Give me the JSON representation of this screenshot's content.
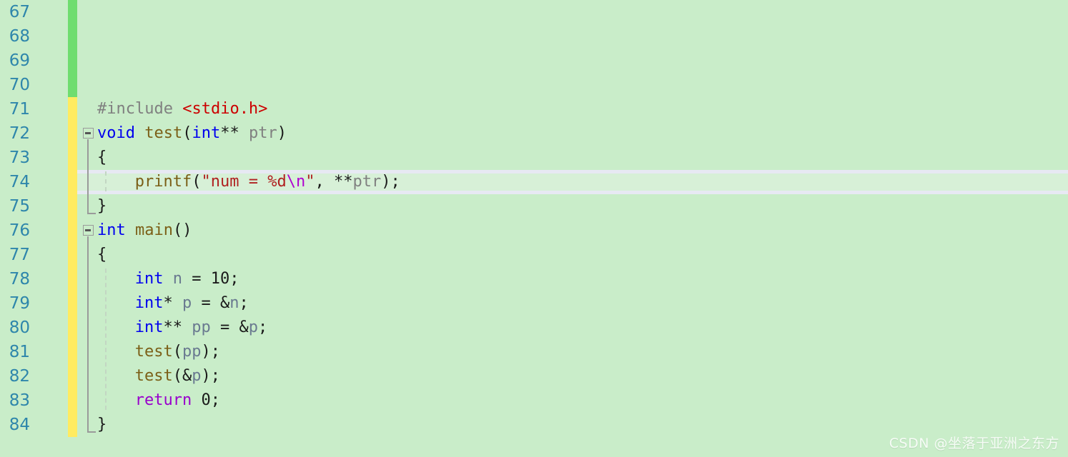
{
  "editor": {
    "background_color": "#c9edc9",
    "line_number_color": "#2e86ab",
    "highlighted_line_number": 74,
    "first_visible_line": 67,
    "last_visible_line": 84
  },
  "gutter": {
    "line_numbers": [
      "67",
      "68",
      "69",
      "70",
      "71",
      "72",
      "73",
      "74",
      "75",
      "76",
      "77",
      "78",
      "79",
      "80",
      "81",
      "82",
      "83",
      "84"
    ],
    "change_bars": [
      {
        "name": "saved-changes-bar",
        "color": "#6fdd6f",
        "from_line": 67,
        "to_line": 70
      },
      {
        "name": "unsaved-changes-bar",
        "color": "#ffeb60",
        "from_line": 71,
        "to_line": 84
      }
    ]
  },
  "fold_markers": [
    {
      "line": 72,
      "state": "expanded",
      "glyph": "minus"
    },
    {
      "line": 76,
      "state": "expanded",
      "glyph": "minus"
    }
  ],
  "code": {
    "language": "c",
    "lines": [
      {
        "number": "67",
        "text": ""
      },
      {
        "number": "68",
        "text": ""
      },
      {
        "number": "69",
        "text": ""
      },
      {
        "number": "70",
        "text": ""
      },
      {
        "number": "71",
        "text": "#include <stdio.h>"
      },
      {
        "number": "72",
        "text": "void test(int** ptr)"
      },
      {
        "number": "73",
        "text": "{"
      },
      {
        "number": "74",
        "text": "    printf(\"num = %d\\n\", **ptr);",
        "highlighted": true
      },
      {
        "number": "75",
        "text": "}"
      },
      {
        "number": "76",
        "text": "int main()"
      },
      {
        "number": "77",
        "text": "{"
      },
      {
        "number": "78",
        "text": "    int n = 10;"
      },
      {
        "number": "79",
        "text": "    int* p = &n;"
      },
      {
        "number": "80",
        "text": "    int** pp = &p;"
      },
      {
        "number": "81",
        "text": "    test(pp);"
      },
      {
        "number": "82",
        "text": "    test(&p);"
      },
      {
        "number": "83",
        "text": "    return 0;"
      },
      {
        "number": "84",
        "text": "}"
      }
    ],
    "tokens": {
      "l71": [
        {
          "t": "#include ",
          "c": "pp"
        },
        {
          "t": "<stdio.h>",
          "c": "inc"
        }
      ],
      "l72": [
        {
          "t": "void",
          "c": "k"
        },
        {
          "t": " ",
          "c": "op"
        },
        {
          "t": "test",
          "c": "fn"
        },
        {
          "t": "(",
          "c": "op"
        },
        {
          "t": "int",
          "c": "k"
        },
        {
          "t": "**",
          "c": "op"
        },
        {
          "t": " ",
          "c": "op"
        },
        {
          "t": "ptr",
          "c": "id"
        },
        {
          "t": ")",
          "c": "op"
        }
      ],
      "l73": [
        {
          "t": "{",
          "c": "op"
        }
      ],
      "l74": [
        {
          "t": "printf",
          "c": "fn"
        },
        {
          "t": "(",
          "c": "op"
        },
        {
          "t": "\"num = %d",
          "c": "str"
        },
        {
          "t": "\\n",
          "c": "esc"
        },
        {
          "t": "\"",
          "c": "str"
        },
        {
          "t": ", ",
          "c": "op"
        },
        {
          "t": "**",
          "c": "op"
        },
        {
          "t": "ptr",
          "c": "id"
        },
        {
          "t": ");",
          "c": "op"
        }
      ],
      "l75": [
        {
          "t": "}",
          "c": "op"
        }
      ],
      "l76": [
        {
          "t": "int",
          "c": "k"
        },
        {
          "t": " ",
          "c": "op"
        },
        {
          "t": "main",
          "c": "fn"
        },
        {
          "t": "()",
          "c": "op"
        }
      ],
      "l77": [
        {
          "t": "{",
          "c": "op"
        }
      ],
      "l78": [
        {
          "t": "int",
          "c": "k"
        },
        {
          "t": " ",
          "c": "op"
        },
        {
          "t": "n",
          "c": "var"
        },
        {
          "t": " = ",
          "c": "op"
        },
        {
          "t": "10",
          "c": "num"
        },
        {
          "t": ";",
          "c": "op"
        }
      ],
      "l79": [
        {
          "t": "int",
          "c": "k"
        },
        {
          "t": "*",
          "c": "op"
        },
        {
          "t": " ",
          "c": "op"
        },
        {
          "t": "p",
          "c": "var"
        },
        {
          "t": " = &",
          "c": "op"
        },
        {
          "t": "n",
          "c": "var"
        },
        {
          "t": ";",
          "c": "op"
        }
      ],
      "l80": [
        {
          "t": "int",
          "c": "k"
        },
        {
          "t": "**",
          "c": "op"
        },
        {
          "t": " ",
          "c": "op"
        },
        {
          "t": "pp",
          "c": "var"
        },
        {
          "t": " = &",
          "c": "op"
        },
        {
          "t": "p",
          "c": "var"
        },
        {
          "t": ";",
          "c": "op"
        }
      ],
      "l81": [
        {
          "t": "test",
          "c": "fn"
        },
        {
          "t": "(",
          "c": "op"
        },
        {
          "t": "pp",
          "c": "var"
        },
        {
          "t": ");",
          "c": "op"
        }
      ],
      "l82": [
        {
          "t": "test",
          "c": "fn"
        },
        {
          "t": "(&",
          "c": "op"
        },
        {
          "t": "p",
          "c": "var"
        },
        {
          "t": ");",
          "c": "op"
        }
      ],
      "l83": [
        {
          "t": "return",
          "c": "ctl"
        },
        {
          "t": " ",
          "c": "op"
        },
        {
          "t": "0",
          "c": "num"
        },
        {
          "t": ";",
          "c": "op"
        }
      ],
      "l84": [
        {
          "t": "}",
          "c": "op"
        }
      ]
    }
  },
  "watermark": {
    "text": "CSDN @坐落于亚洲之东方"
  }
}
